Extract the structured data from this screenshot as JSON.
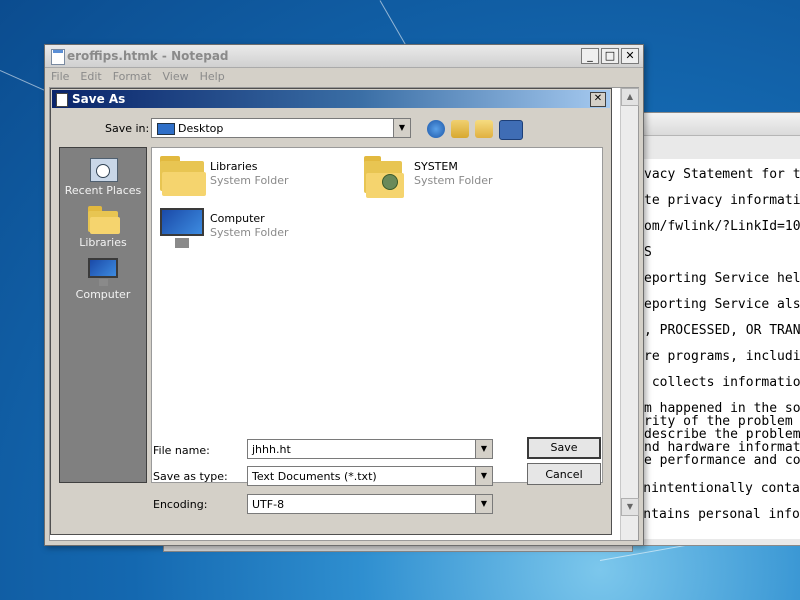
{
  "background_window": {
    "lines": [
      "vacy Statement for t",
      "te privacy informati",
      "om/fwlink/?LinkId=10",
      "S",
      "eporting Service hel",
      "eporting Service als",
      ", PROCESSED, OR TRAN",
      "re programs, includi",
      " collects informatio",
      "m happened in the so",
      "rity of the problem",
      "describe the problem",
      "nd hardware informat",
      "e performance and co",
      "ht unintentionally conta",
      "t contains personal info"
    ]
  },
  "notepad": {
    "title": "eroffips.htmk - Notepad",
    "menu": [
      "File",
      "Edit",
      "Format",
      "View",
      "Help"
    ],
    "caption_buttons": [
      "_",
      "□",
      "✕"
    ]
  },
  "dialog": {
    "title": "Save As",
    "close": "✕",
    "save_in_label": "Save in:",
    "save_in_value": "Desktop",
    "toolbar_icons": [
      "back-arrow-icon",
      "up-folder-icon",
      "new-folder-icon",
      "view-menu-icon"
    ],
    "places": [
      {
        "label": "Recent Places",
        "icon": "recent-places-icon"
      },
      {
        "label": "Libraries",
        "icon": "libraries-icon"
      },
      {
        "label": "Computer",
        "icon": "computer-icon"
      }
    ],
    "files": [
      {
        "name": "Libraries",
        "type": "System Folder",
        "icon": "libraries-folder-icon"
      },
      {
        "name": "SYSTEM",
        "type": "System Folder",
        "icon": "user-folder-icon"
      },
      {
        "name": "Computer",
        "type": "System Folder",
        "icon": "computer-icon"
      }
    ],
    "file_name_label": "File name:",
    "file_name_value": "jhhh.ht",
    "save_type_label": "Save as type:",
    "save_type_value": "Text Documents (*.txt)",
    "encoding_label": "Encoding:",
    "encoding_value": "UTF-8",
    "save_button": "Save",
    "cancel_button": "Cancel"
  }
}
